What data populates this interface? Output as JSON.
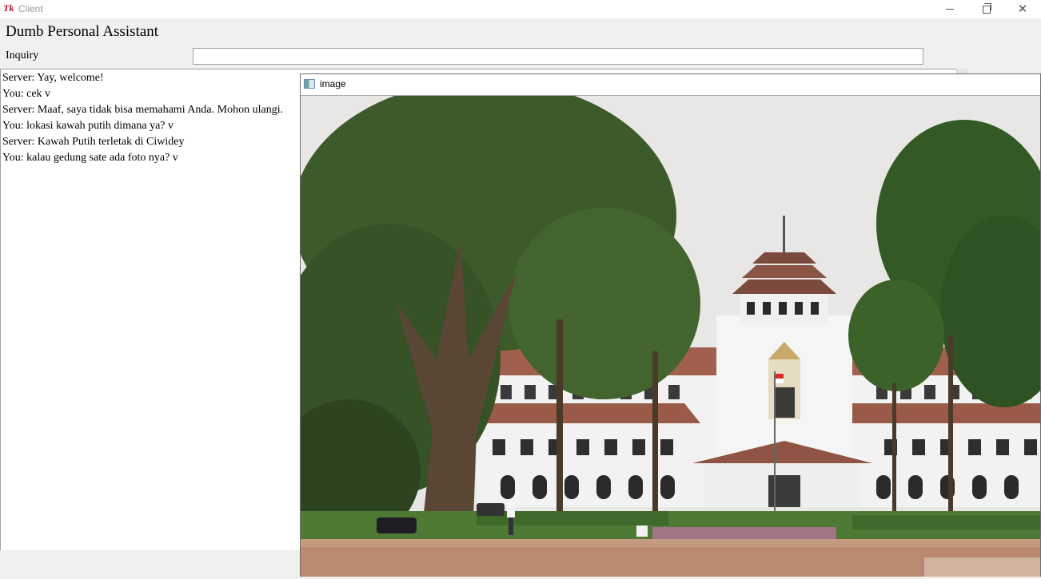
{
  "window": {
    "title": "Client",
    "logo_text": "Tk",
    "controls": {
      "minimize_icon": "minimize-icon",
      "maximize_icon": "restore-icon",
      "close_icon": "close-icon"
    }
  },
  "app": {
    "heading": "Dumb Personal Assistant",
    "inquiry_label": "Inquiry",
    "inquiry_value": ""
  },
  "chat": {
    "lines": [
      "Server: Yay, welcome!",
      "You: cek v",
      "Server: Maaf, saya tidak bisa memahami Anda. Mohon ulangi.",
      "You: lokasi kawah putih dimana ya? v",
      "Server: Kawah Putih terletak di Ciwidey",
      "You: kalau gedung sate ada foto nya? v"
    ]
  },
  "image_window": {
    "title": "image",
    "icon": "image-window-icon",
    "photo": "gedung-sate-photo"
  },
  "colors": {
    "tk_logo": "#c8102e",
    "sky": "#e9e6e6",
    "building": "#f2f2f2",
    "roof": "#9a5a48",
    "foliage": "#3d5a2a",
    "lawn": "#4f7a36",
    "path": "#b98a70"
  }
}
